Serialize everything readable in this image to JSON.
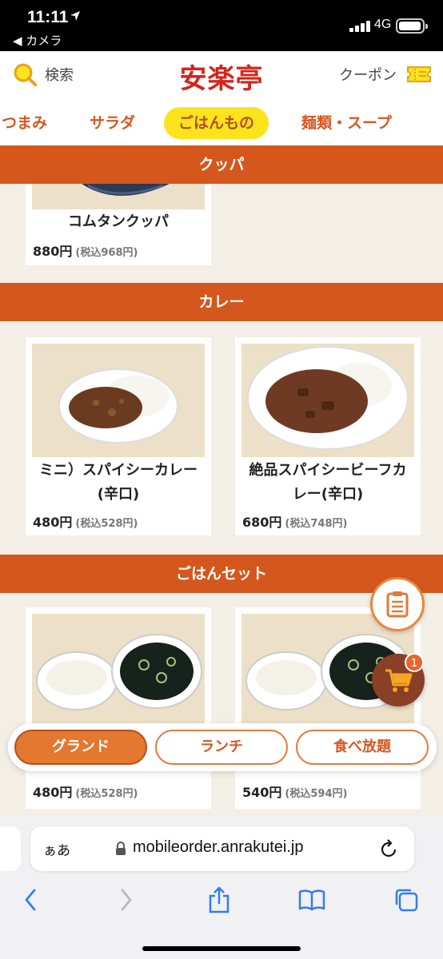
{
  "status_bar": {
    "time": "11:11",
    "back_app": "◀ カメラ",
    "network": "4G"
  },
  "header": {
    "search_label": "検索",
    "logo": "安楽亭",
    "coupon_label": "クーポン"
  },
  "categories": [
    {
      "label": "つまみ"
    },
    {
      "label": "サラダ"
    },
    {
      "label": "ごはんもの"
    },
    {
      "label": "麺類・スープ"
    }
  ],
  "active_category": "ごはんもの",
  "sections": [
    {
      "title": "クッパ"
    },
    {
      "title": "カレー"
    },
    {
      "title": "ごはんセット"
    }
  ],
  "items": [
    {
      "name": "コムタンクッパ",
      "price": "880円",
      "tax_price": "(税込968円)"
    },
    {
      "name_line1": "ミニ）スパイシーカレー",
      "name_line2": "(辛口)",
      "price": "480円",
      "tax_price": "(税込528円)"
    },
    {
      "name_line1": "絶品スパイシービーフカ",
      "name_line2": "レー(辛口)",
      "price": "680円",
      "tax_price": "(税込748円)"
    },
    {
      "price": "480円",
      "tax_price": "(税込528円)"
    },
    {
      "price": "540円",
      "tax_price": "(税込594円)"
    }
  ],
  "cart": {
    "count": "1"
  },
  "mode_tabs": [
    {
      "label": "グランド"
    },
    {
      "label": "ランチ"
    },
    {
      "label": "食べ放題"
    }
  ],
  "active_mode": "グランド",
  "browser": {
    "aa_label": "ぁあ",
    "url": "mobileorder.anrakutei.jp"
  },
  "colors": {
    "accent_orange": "#d4571d",
    "active_yellow": "#fbe31e",
    "logo_red": "#d5241c",
    "cart_brown": "#8a3f27"
  }
}
